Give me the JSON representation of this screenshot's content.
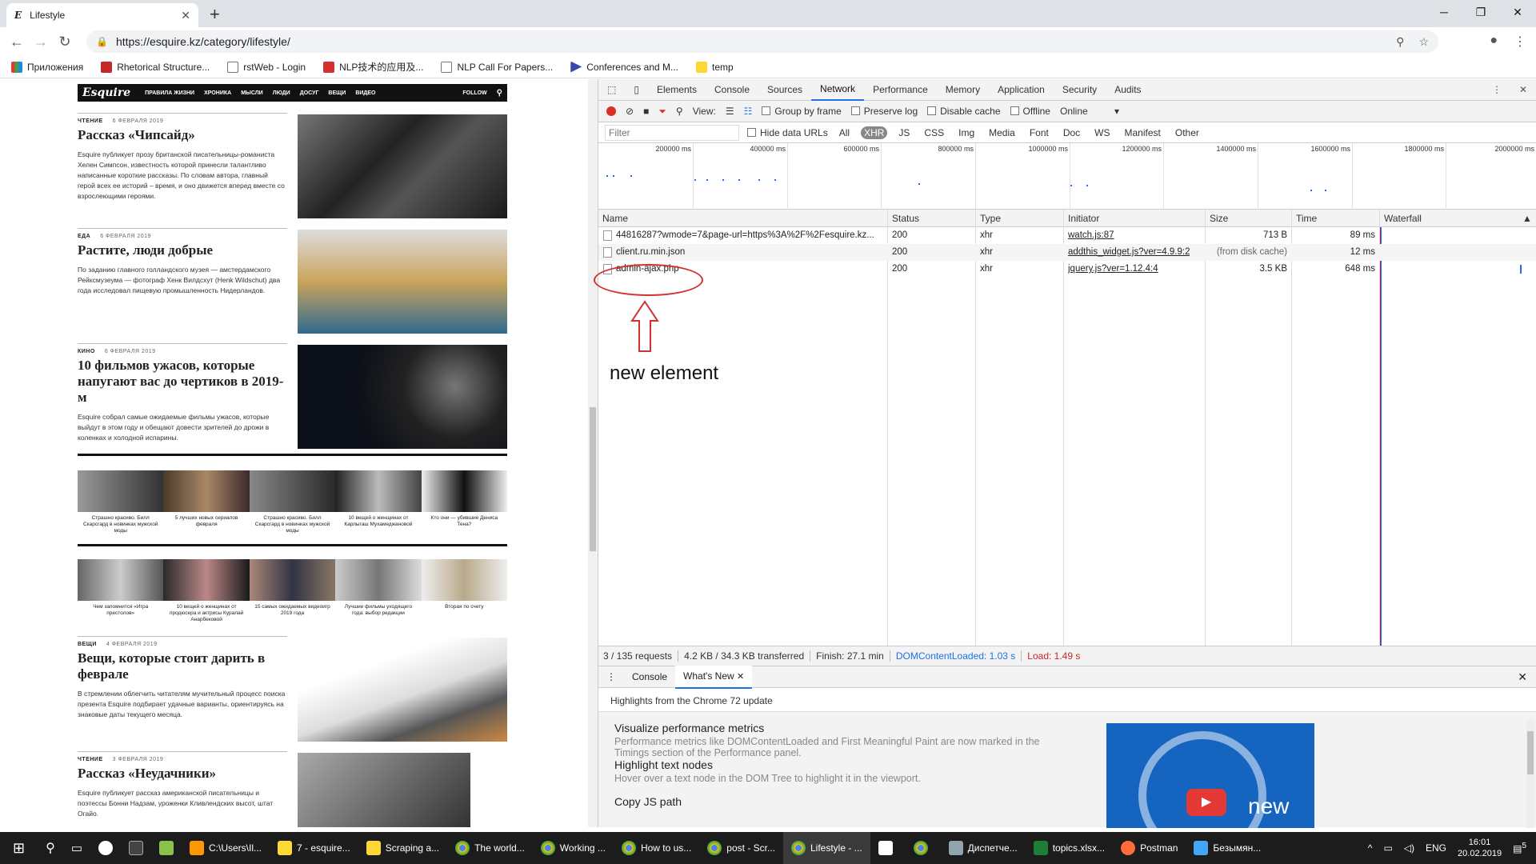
{
  "browser": {
    "tab_title": "Lifestyle",
    "url": "https://esquire.kz/category/lifestyle/",
    "bookmarks": [
      "Приложения",
      "Rhetorical Structure...",
      "rstWeb - Login",
      "NLP技术的应用及...",
      "NLP Call For Papers...",
      "Conferences and M...",
      "temp"
    ]
  },
  "page": {
    "nav": {
      "logo": "Esquire",
      "items": [
        "ПРАВИЛА ЖИЗНИ",
        "ХРОНИКА",
        "МЫСЛИ",
        "ЛЮДИ",
        "ДОСУГ",
        "ВЕЩИ",
        "ВИДЕО"
      ],
      "follow": "FOLLOW"
    },
    "articles": [
      {
        "category": "ЧТЕНИЕ",
        "date": "6 ФЕВРАЛЯ 2019",
        "title": "Рассказ «Чипсайд»",
        "text": "Esquire публикует прозу британской писательницы-романиста Хелен Симпсон, известность которой принесли талантливо написанные короткие рассказы. По словам автора, главный герой всех ее историй – время, и оно движется вперед вместе со взрослеющими героями."
      },
      {
        "category": "ЕДА",
        "date": "6 ФЕВРАЛЯ 2019",
        "title": "Растите, люди добрые",
        "text": "По заданию главного голландского музея — амстердамского Рейксмузеума — фотограф Хенк Вилдсхут (Henk Wildschut) два года исследовал пищевую промышленность Нидерландов."
      },
      {
        "category": "КИНО",
        "date": "6 ФЕВРАЛЯ 2019",
        "title": "10 фильмов ужасов, которые напугают вас до чертиков в 2019-м",
        "text": "Esquire собрал самые ожидаемые фильмы ужасов, которые выйдут в этом году и обещают довести зрителей до дрожи в коленках и холодной испарины."
      },
      {
        "category": "ВЕЩИ",
        "date": "4 ФЕВРАЛЯ 2019",
        "title": "Вещи, которые стоит дарить в феврале",
        "text": "В стремлении облегчить читателям мучительный процесс поиска презента Esquire подбирает удачные варианты, ориентируясь на знаковые даты текущего месяца."
      },
      {
        "category": "ЧТЕНИЕ",
        "date": "3 ФЕВРАЛЯ 2019",
        "title": "Рассказ «Неудачники»",
        "text": "Esquire публикует рассказ американской писательницы и поэтессы Бонни Надзам, уроженки Кливлендских высот, штат Огайо."
      }
    ],
    "carousel1": [
      "Страшно красиво. Билл Скарсгард в новинках мужской моды",
      "5 лучших новых сериалов февраля",
      "Страшно красиво. Билл Скарсгард в новинках мужской моды",
      "10 вещей о женщинах от Карлыгаш Мухамеджановой",
      "Кто они — убившие Дениса Тена?"
    ],
    "carousel2": [
      "Чем запомнится «Игра престолов»",
      "10 вещей о женщинах от продюсера и актрисы Куралай Анарбековой",
      "15 самых ожидаемых видеоигр 2019 года",
      "Лучшие фильмы уходящего года: выбор редакции",
      "Вторая по счету"
    ]
  },
  "devtools": {
    "tabs": [
      "Elements",
      "Console",
      "Sources",
      "Network",
      "Performance",
      "Memory",
      "Application",
      "Security",
      "Audits"
    ],
    "active_tab": "Network",
    "toolbar": {
      "view": "View:",
      "group_by_frame": "Group by frame",
      "preserve_log": "Preserve log",
      "disable_cache": "Disable cache",
      "offline": "Offline",
      "throttle": "Online"
    },
    "filter": {
      "placeholder": "Filter",
      "hide_data_urls": "Hide data URLs",
      "types": [
        "All",
        "XHR",
        "JS",
        "CSS",
        "Img",
        "Media",
        "Font",
        "Doc",
        "WS",
        "Manifest",
        "Other"
      ],
      "selected": "XHR"
    },
    "overview_ticks": [
      "200000 ms",
      "400000 ms",
      "600000 ms",
      "800000 ms",
      "1000000 ms",
      "1200000 ms",
      "1400000 ms",
      "1600000 ms",
      "1800000 ms",
      "2000000 ms"
    ],
    "columns": [
      "Name",
      "Status",
      "Type",
      "Initiator",
      "Size",
      "Time",
      "Waterfall"
    ],
    "requests": [
      {
        "name": "44816287?wmode=7&page-url=https%3A%2F%2Fesquire.kz...",
        "status": "200",
        "type": "xhr",
        "initiator": "watch.js:87",
        "size": "713 B",
        "time": "89 ms"
      },
      {
        "name": "client.ru.min.json",
        "status": "200",
        "type": "xhr",
        "initiator": "addthis_widget.js?ver=4.9.9:2",
        "size": "(from disk cache)",
        "time": "12 ms"
      },
      {
        "name": "admin-ajax.php",
        "status": "200",
        "type": "xhr",
        "initiator": "jquery.js?ver=1.12.4:4",
        "size": "3.5 KB",
        "time": "648 ms"
      }
    ],
    "summary": {
      "requests": "3 / 135 requests",
      "transferred": "4.2 KB / 34.3 KB transferred",
      "finish": "Finish: 27.1 min",
      "dom": "DOMContentLoaded: 1.03 s",
      "load": "Load: 1.49 s"
    },
    "drawer": {
      "tabs": [
        "Console",
        "What's New"
      ],
      "highlights": "Highlights from the Chrome 72 update",
      "items": [
        {
          "title": "Visualize performance metrics",
          "desc": "Performance metrics like DOMContentLoaded and First Meaningful Paint are now marked in the Timings section of the Performance panel."
        },
        {
          "title": "Highlight text nodes",
          "desc": "Hover over a text node in the DOM Tree to highlight it in the viewport."
        },
        {
          "title": "Copy JS path",
          "desc": ""
        }
      ],
      "image_caption": "new"
    }
  },
  "annotation": {
    "text": "new element"
  },
  "taskbar": {
    "items": [
      "C:\\Users\\Il...",
      "7 - esquire...",
      "Scraping a...",
      "The world...",
      "Working ...",
      "How to us...",
      "post - Scr...",
      "Lifestyle - ...",
      "",
      "",
      "Диспетче...",
      "topics.xlsx...",
      "Postman",
      "Безымян..."
    ],
    "lang": "ENG",
    "time": "16:01",
    "date": "20.02.2019",
    "notifications": "5"
  },
  "colors": {
    "accent": "#1a73e8",
    "record": "#d93025",
    "annotation": "#d32f2f",
    "taskbar": "#1c1c1c"
  }
}
